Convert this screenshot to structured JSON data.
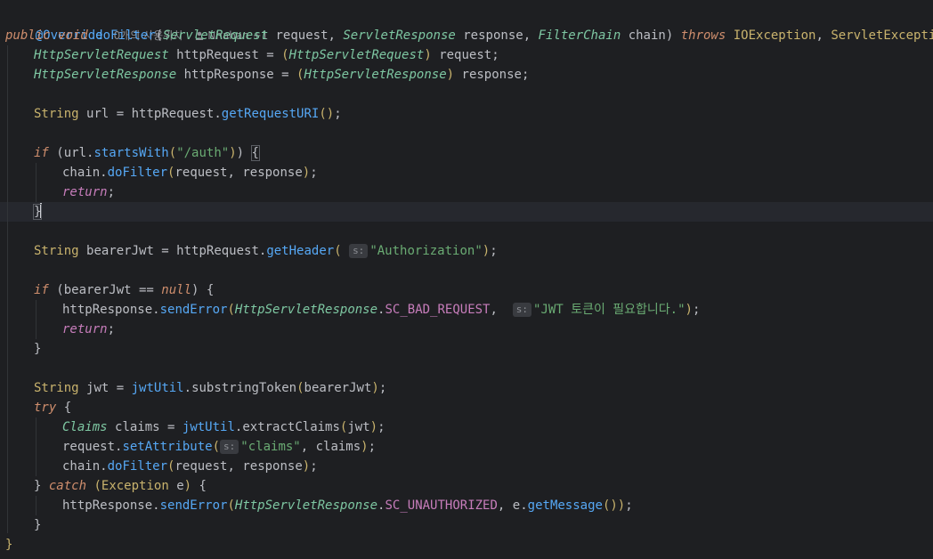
{
  "meta": {
    "annotation": "@Override",
    "usages": "0개의 사용위치",
    "author": "Nhahan +1"
  },
  "code": {
    "l1": {
      "kw": "public",
      "void": "void",
      "name": "doFilter",
      "t1": "ServletRequest",
      "p1": "request",
      "t2": "ServletResponse",
      "p2": "response",
      "t3": "FilterChain",
      "p3": "chain",
      "throws": "throws",
      "e1": "IOException",
      "e2": "ServletException"
    },
    "l2": {
      "type": "HttpServletRequest",
      "var": "httpRequest",
      "cast": "HttpServletRequest",
      "src": "request"
    },
    "l3": {
      "type": "HttpServletResponse",
      "var": "httpResponse",
      "cast": "HttpServletResponse",
      "src": "response"
    },
    "l5": {
      "type": "String",
      "var": "url",
      "obj": "httpRequest",
      "method": "getRequestURI"
    },
    "l7": {
      "kw": "if",
      "obj": "url",
      "method": "startsWith",
      "arg": "\"/auth\""
    },
    "l8": {
      "obj": "chain",
      "method": "doFilter",
      "a1": "request",
      "a2": "response"
    },
    "l9": {
      "kw": "return"
    },
    "l12": {
      "type": "String",
      "var": "bearerJwt",
      "obj": "httpRequest",
      "method": "getHeader",
      "hint": "s:",
      "arg": "\"Authorization\""
    },
    "l14": {
      "kw": "if",
      "var": "bearerJwt",
      "null": "null"
    },
    "l15": {
      "obj": "httpResponse",
      "method": "sendError",
      "cls": "HttpServletResponse",
      "const": "SC_BAD_REQUEST",
      "hint": "s:",
      "msg": "\"JWT 토큰이 필요합니다.\""
    },
    "l16": {
      "kw": "return"
    },
    "l19": {
      "type": "String",
      "var": "jwt",
      "obj": "jwtUtil",
      "method": "substringToken",
      "arg": "bearerJwt"
    },
    "l20": {
      "kw": "try"
    },
    "l21": {
      "type": "Claims",
      "var": "claims",
      "obj": "jwtUtil",
      "method": "extractClaims",
      "arg": "jwt"
    },
    "l22": {
      "obj": "request",
      "method": "setAttribute",
      "hint": "s:",
      "arg1": "\"claims\"",
      "arg2": "claims"
    },
    "l23": {
      "obj": "chain",
      "method": "doFilter",
      "a1": "request",
      "a2": "response"
    },
    "l24": {
      "kw": "catch",
      "type": "Exception",
      "var": "e"
    },
    "l25": {
      "obj": "httpResponse",
      "method": "sendError",
      "cls": "HttpServletResponse",
      "const": "SC_UNAUTHORIZED",
      "var": "e",
      "m2": "getMessage"
    }
  }
}
